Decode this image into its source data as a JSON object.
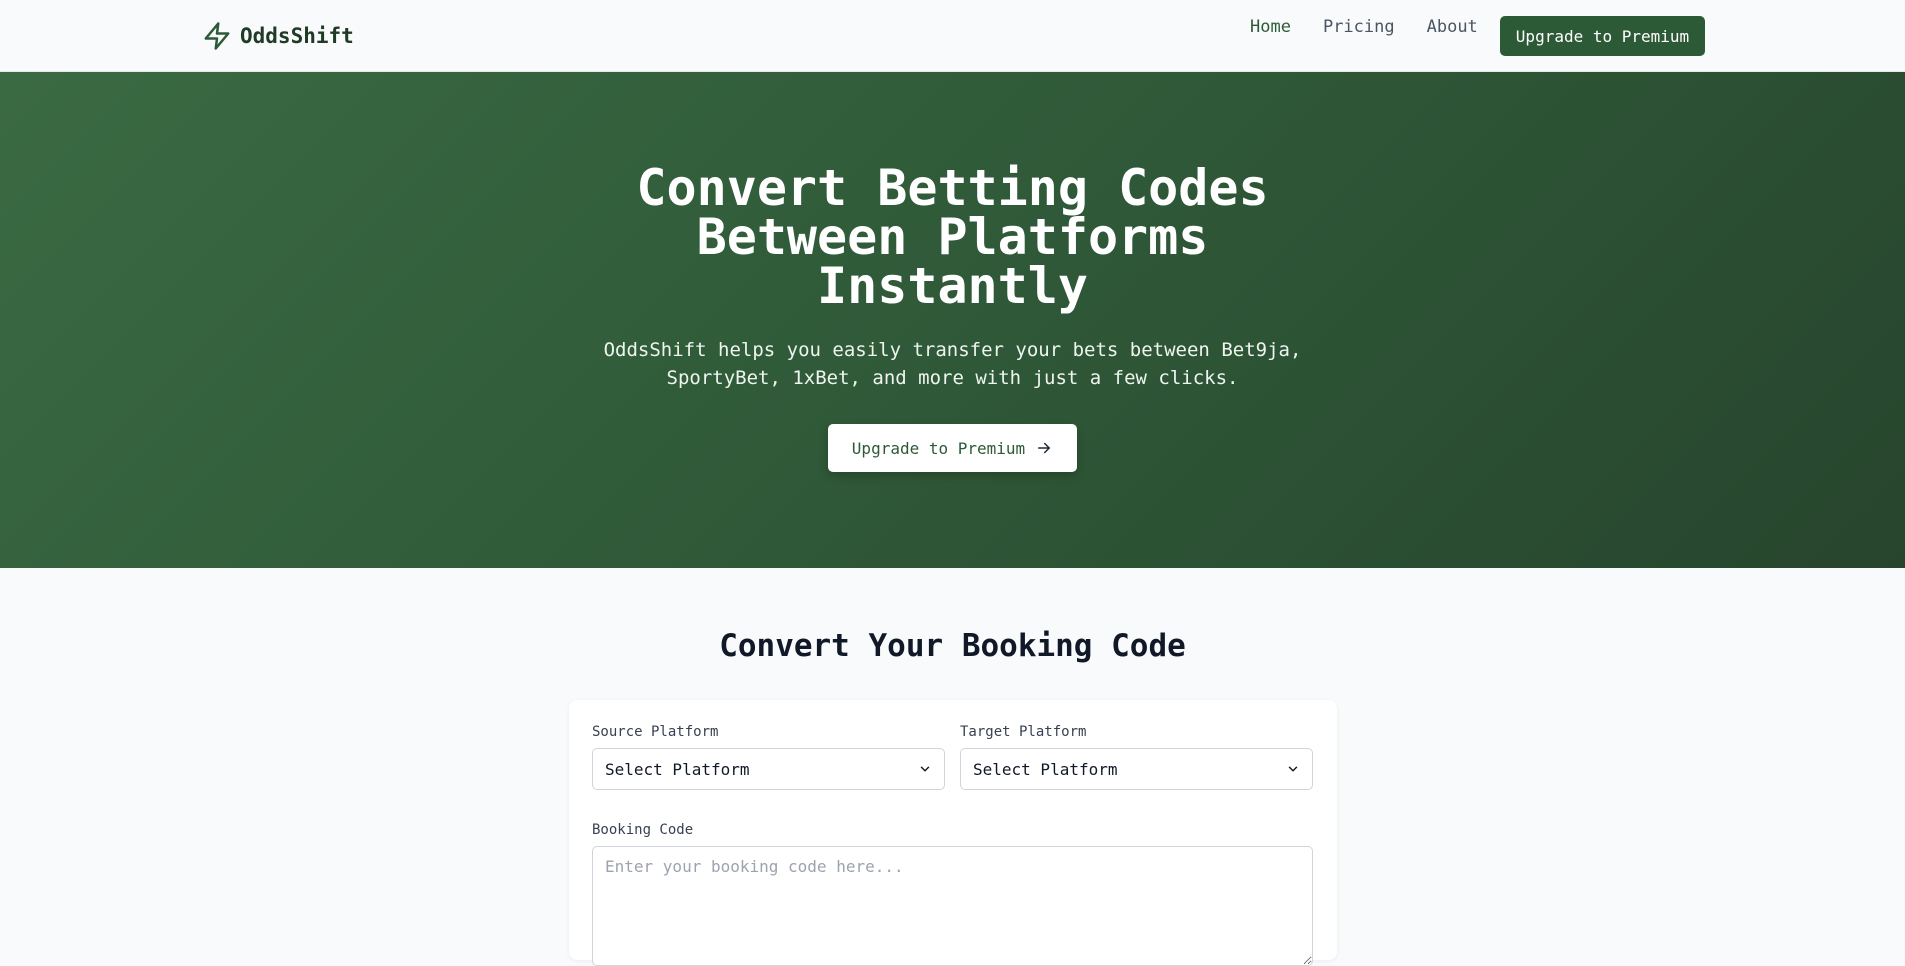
{
  "brand": {
    "name": "OddsShift",
    "icon": "lightning-bolt-icon"
  },
  "nav": {
    "links": [
      {
        "label": "Home",
        "active": true
      },
      {
        "label": "Pricing",
        "active": false
      },
      {
        "label": "About",
        "active": false
      }
    ],
    "cta_label": "Upgrade to Premium"
  },
  "hero": {
    "title": "Convert Betting Codes Between Platforms Instantly",
    "subtitle": "OddsShift helps you easily transfer your bets between Bet9ja, SportyBet, 1xBet, and more with just a few clicks.",
    "cta_label": "Upgrade to Premium",
    "cta_icon": "arrow-right-icon"
  },
  "converter": {
    "title": "Convert Your Booking Code",
    "source_label": "Source Platform",
    "source_value": "Select Platform",
    "target_label": "Target Platform",
    "target_value": "Select Platform",
    "code_label": "Booking Code",
    "code_placeholder": "Enter your booking code here..."
  },
  "colors": {
    "accent": "#2d5a36",
    "hero_start": "#3a6a42",
    "hero_end": "#27452d",
    "background": "#f8fafc"
  }
}
